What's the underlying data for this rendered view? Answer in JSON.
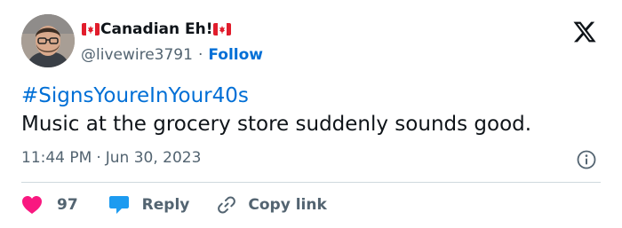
{
  "author": {
    "display_name_flag_left": "🇨🇦",
    "display_name": "Canadian Eh!",
    "display_name_flag_right": "🇨🇦",
    "handle": "@livewire3791",
    "separator": "·",
    "follow_label": "Follow"
  },
  "tweet": {
    "hashtag": "#SignsYoureInYour40s",
    "text": "Music at the grocery store suddenly sounds good.",
    "time": "11:44 PM",
    "separator": "·",
    "date": "Jun 30, 2023"
  },
  "actions": {
    "like_count": "97",
    "reply_label": "Reply",
    "copy_link_label": "Copy link"
  },
  "icons": {
    "logo": "x-logo-icon",
    "info": "info-icon",
    "like": "heart-icon",
    "reply": "speech-bubble-icon",
    "copy": "link-icon"
  },
  "colors": {
    "link_blue": "#006fd6",
    "like_pink": "#f91880",
    "reply_blue": "#1d9bf0",
    "text_primary": "#0f1419",
    "text_secondary": "#536471",
    "divider": "#cfd9de",
    "flag_red": "#e11d2c"
  }
}
